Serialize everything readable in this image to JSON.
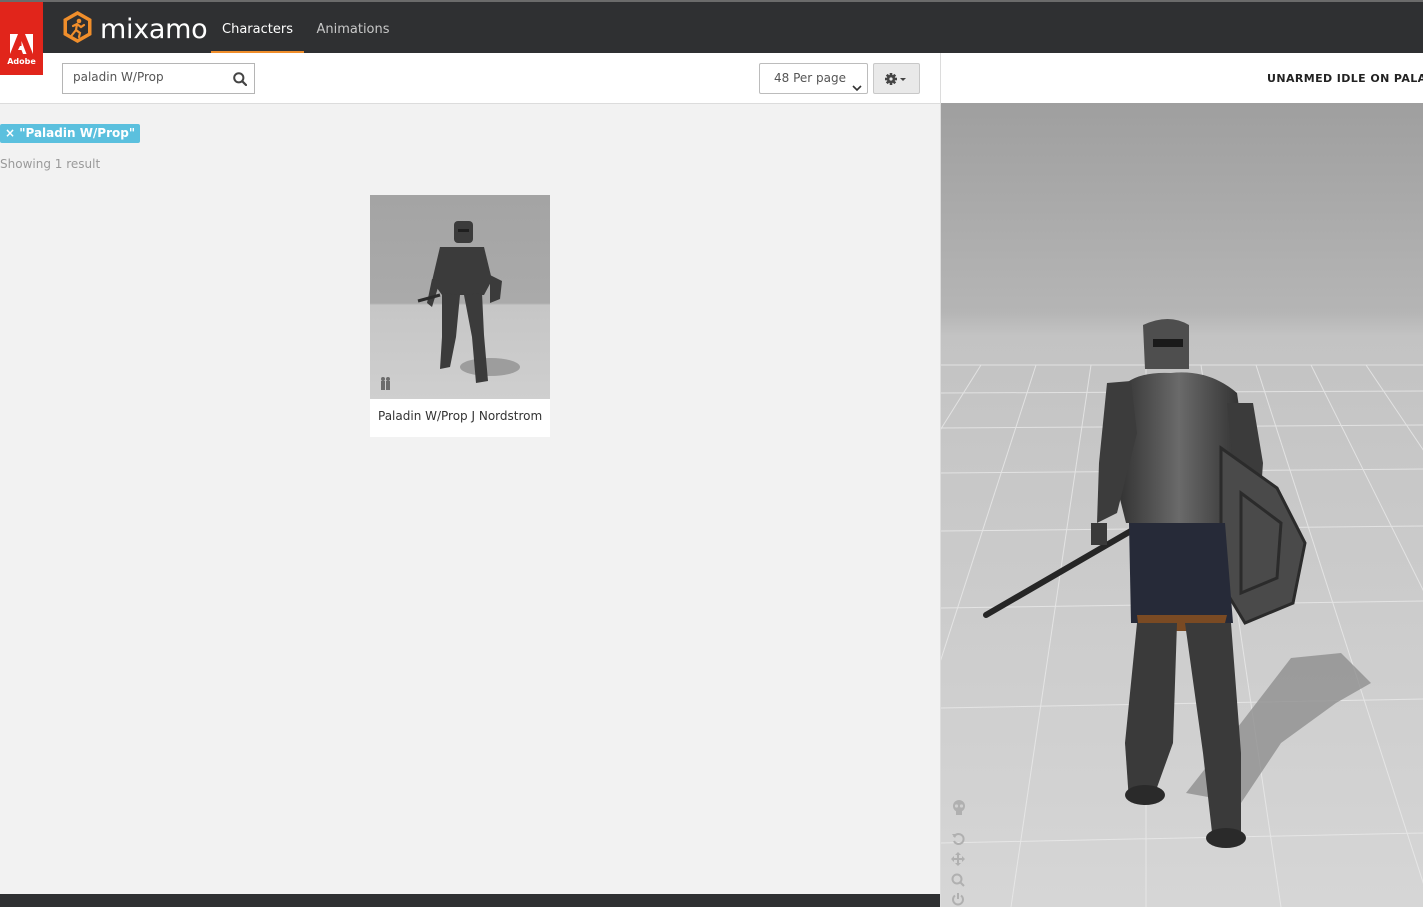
{
  "brand": {
    "adobe_label": "Adobe",
    "app_name": "mixamo"
  },
  "nav": {
    "tabs": [
      {
        "label": "Characters",
        "active": true
      },
      {
        "label": "Animations",
        "active": false
      }
    ]
  },
  "toolbar": {
    "search_value": "paladin W/Prop",
    "per_page_label": "48 Per page"
  },
  "results": {
    "filter_chip": "× \"Paladin W/Prop\"",
    "count_text": "Showing 1 result",
    "items": [
      {
        "title": "Paladin W/Prop J Nordstrom"
      }
    ]
  },
  "preview": {
    "animation_title": "UNARMED IDLE ON PALADI"
  },
  "colors": {
    "topbar": "#2f3032",
    "adobe_red": "#e1251b",
    "accent_orange": "#f08e2b",
    "chip_blue": "#5bc0de"
  },
  "icons": {
    "search": "search-icon",
    "gear": "gear-icon",
    "dropdown": "chevron-down-icon",
    "viewport_tools": [
      "skeleton-icon",
      "reset-icon",
      "move-icon",
      "zoom-icon",
      "power-icon"
    ]
  }
}
